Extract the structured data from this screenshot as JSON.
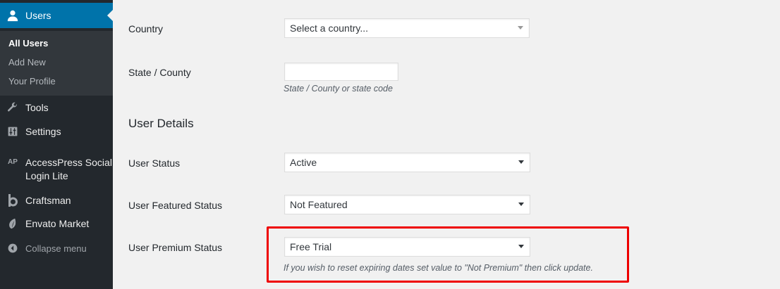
{
  "sidebar": {
    "users": {
      "label": "Users",
      "icon": "user-icon"
    },
    "submenu": [
      {
        "label": "All Users",
        "active": true
      },
      {
        "label": "Add New",
        "active": false
      },
      {
        "label": "Your Profile",
        "active": false
      }
    ],
    "tools": {
      "label": "Tools",
      "icon": "wrench-icon"
    },
    "settings": {
      "label": "Settings",
      "icon": "settings-sliders-icon"
    },
    "accesspress": {
      "label_line1": "AccessPress Social",
      "label_line2": "Login Lite",
      "icon_text": "AP"
    },
    "craftsman": {
      "label": "Craftsman",
      "icon": "craftsman-logo-icon"
    },
    "envato": {
      "label": "Envato Market",
      "icon": "leaf-icon"
    },
    "collapse": {
      "label": "Collapse menu",
      "icon": "collapse-arrow-icon"
    }
  },
  "form": {
    "country": {
      "label": "Country",
      "value": "Select a country..."
    },
    "state": {
      "label": "State / County",
      "value": "",
      "description": "State / County or state code"
    },
    "section_heading": "User Details",
    "user_status": {
      "label": "User Status",
      "value": "Active"
    },
    "featured_status": {
      "label": "User Featured Status",
      "value": "Not Featured"
    },
    "premium_status": {
      "label": "User Premium Status",
      "value": "Free Trial",
      "description": "If you wish to reset expiring dates set value to \"Not Premium\" then click update."
    }
  },
  "colors": {
    "sidebar_bg": "#23282d",
    "submenu_bg": "#32373c",
    "accent": "#0073aa",
    "highlight_border": "#ee0000",
    "page_bg": "#f1f1f1"
  }
}
